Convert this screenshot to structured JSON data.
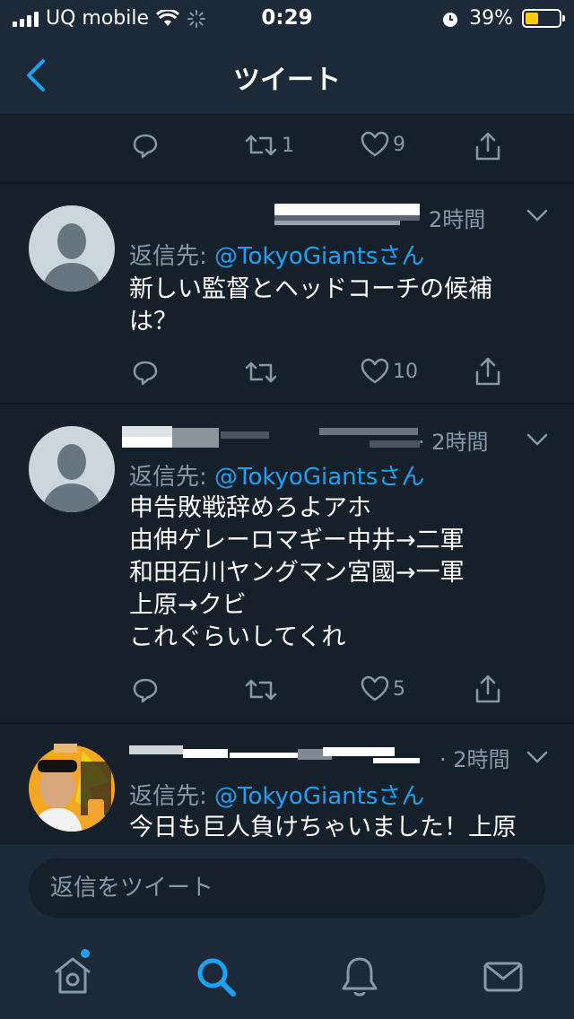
{
  "status_bar": {
    "carrier": "UQ mobile",
    "time": "0:29",
    "battery_percent": "39%",
    "battery_level": 0.39,
    "battery_color": "#ffcc00"
  },
  "nav": {
    "title": "ツイート",
    "back_icon": "chevron-left-icon"
  },
  "main_tweet_actions": {
    "reply_count": "",
    "retweet_count": "1",
    "like_count": "9"
  },
  "tweets": [
    {
      "time": "2時間",
      "reply_to_prefix": "返信先: ",
      "reply_to_handle": "@TokyoGiantsさん",
      "text": "新しい監督とヘッドコーチの候補は？",
      "retweet_count": "",
      "like_count": "10"
    },
    {
      "time": "· 2時間",
      "reply_to_prefix": "返信先: ",
      "reply_to_handle": "@TokyoGiantsさん",
      "text_lines": [
        "申告敗戦辞めろよアホ",
        "由伸ゲレーロマギー中井→二軍",
        "和田石川ヤングマン宮國→一軍",
        "上原→クビ",
        "これぐらいしてくれ"
      ],
      "retweet_count": "",
      "like_count": "5"
    },
    {
      "time": "· 2時間",
      "reply_to_prefix": "返信先: ",
      "reply_to_handle": "@TokyoGiantsさん",
      "text": "今日も巨人負けちゃいました！上原"
    }
  ],
  "reply_bar": {
    "placeholder": "返信をツイート"
  },
  "tabs": [
    "home-icon",
    "search-icon",
    "bell-icon",
    "mail-icon"
  ],
  "colors": {
    "background": "#15202b",
    "bar": "#1c2938",
    "accent": "#1da1f2",
    "muted": "#8899a6"
  }
}
